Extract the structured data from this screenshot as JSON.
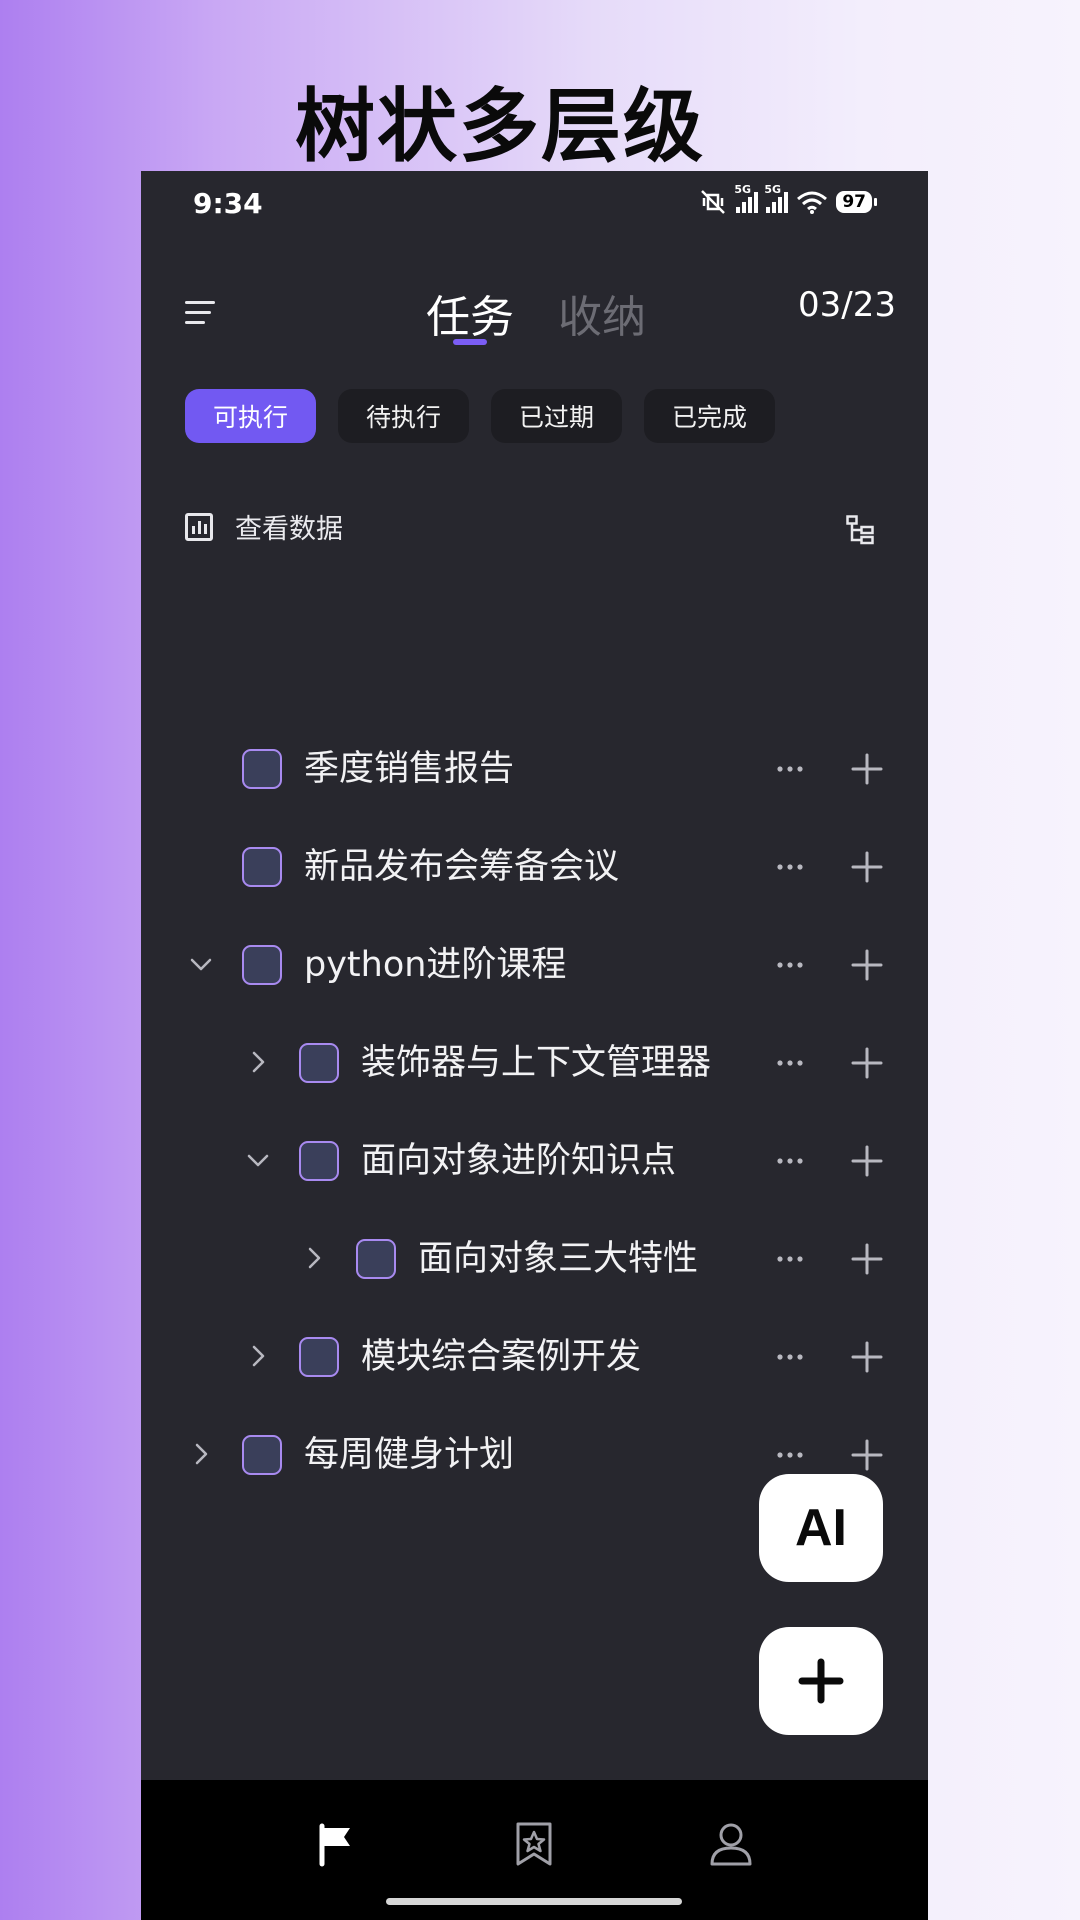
{
  "promo": {
    "title": "树状多层级"
  },
  "status": {
    "time": "9:34",
    "signal1": "5G",
    "signal2": "5G",
    "battery": "97"
  },
  "header": {
    "tabs": [
      {
        "label": "任务",
        "active": true
      },
      {
        "label": "收纳",
        "active": false
      }
    ],
    "date": "03/23"
  },
  "filters": [
    {
      "label": "可执行",
      "active": true
    },
    {
      "label": "待执行",
      "active": false
    },
    {
      "label": "已过期",
      "active": false
    },
    {
      "label": "已完成",
      "active": false
    }
  ],
  "data_link": {
    "label": "查看数据",
    "icon": "bar-chart-icon"
  },
  "tasks": [
    {
      "title": "季度销售报告",
      "level": 0,
      "expander": "none"
    },
    {
      "title": "新品发布会筹备会议",
      "level": 0,
      "expander": "none"
    },
    {
      "title": "python进阶课程",
      "level": 0,
      "expander": "expanded"
    },
    {
      "title": "装饰器与上下文管理器",
      "level": 1,
      "expander": "collapsed"
    },
    {
      "title": "面向对象进阶知识点",
      "level": 1,
      "expander": "expanded"
    },
    {
      "title": "面向对象三大特性",
      "level": 2,
      "expander": "collapsed"
    },
    {
      "title": "模块综合案例开发",
      "level": 1,
      "expander": "collapsed"
    },
    {
      "title": "每周健身计划",
      "level": 0,
      "expander": "collapsed"
    }
  ],
  "fab": {
    "ai_label": "AI"
  },
  "colors": {
    "accent": "#7259f2",
    "background": "#27272e",
    "checkbox_border": "#a88af0"
  },
  "bottom_nav": [
    {
      "name": "flag-icon",
      "active": true
    },
    {
      "name": "bookmark-star-icon",
      "active": false
    },
    {
      "name": "profile-icon",
      "active": false
    }
  ]
}
